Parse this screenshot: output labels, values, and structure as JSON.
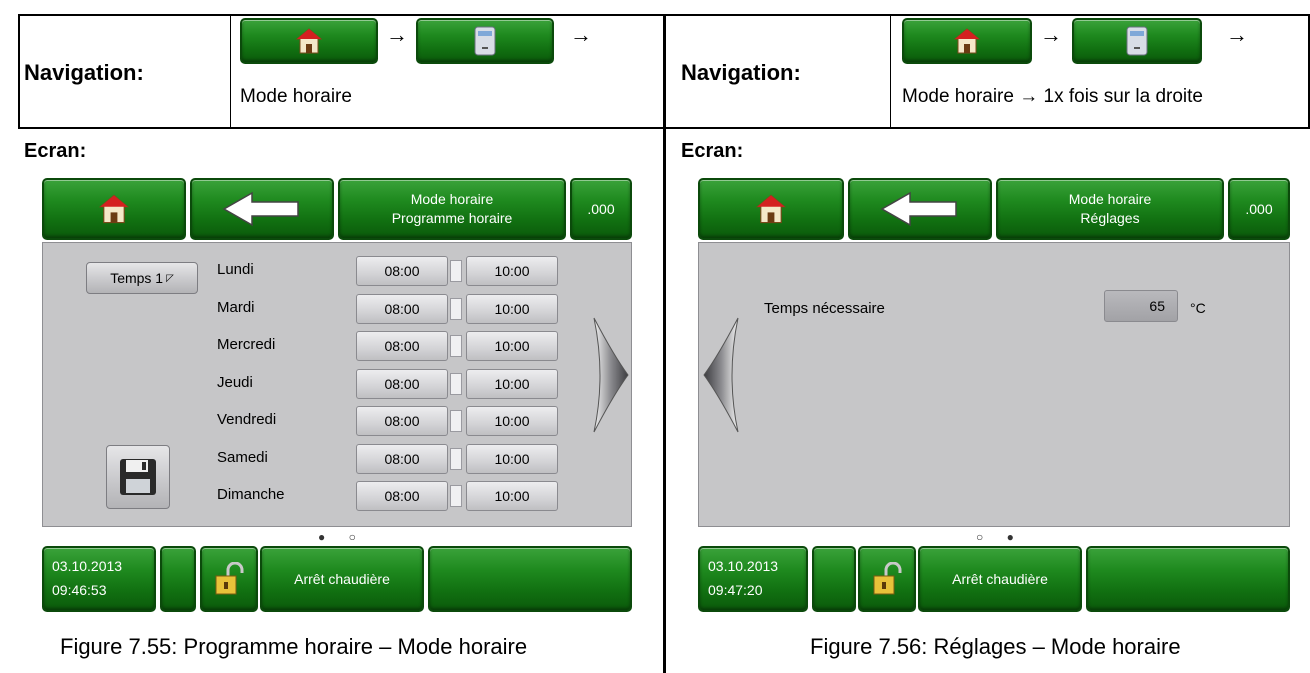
{
  "left": {
    "nav_label": "Navigation:",
    "nav_path": "Mode horaire",
    "ecran_label": "Ecran:",
    "header": {
      "home_icon": "house-icon",
      "back_icon": "back-arrow-icon",
      "title_line1": "Mode horaire",
      "title_line2": "Programme horaire",
      "code": ".000"
    },
    "temps_button": "Temps 1",
    "days": [
      {
        "name": "Lundi",
        "start": "08:00",
        "end": "10:00"
      },
      {
        "name": "Mardi",
        "start": "08:00",
        "end": "10:00"
      },
      {
        "name": "Mercredi",
        "start": "08:00",
        "end": "10:00"
      },
      {
        "name": "Jeudi",
        "start": "08:00",
        "end": "10:00"
      },
      {
        "name": "Vendredi",
        "start": "08:00",
        "end": "10:00"
      },
      {
        "name": "Samedi",
        "start": "08:00",
        "end": "10:00"
      },
      {
        "name": "Dimanche",
        "start": "08:00",
        "end": "10:00"
      }
    ],
    "separator": "-",
    "pager": "● ○",
    "footer": {
      "date": "03.10.2013",
      "time": "09:46:53",
      "status": "Arrêt chaudière"
    },
    "caption": "Figure 7.55: Programme horaire – Mode horaire"
  },
  "right": {
    "nav_label": "Navigation:",
    "nav_path": "Mode horaire → 1x fois sur la droite",
    "ecran_label": "Ecran:",
    "header": {
      "title_line1": "Mode horaire",
      "title_line2": "Réglages",
      "code": ".000"
    },
    "setting_label": "Temps nécessaire",
    "setting_value": "65",
    "setting_unit": "°C",
    "pager": "○ ●",
    "footer": {
      "date": "03.10.2013",
      "time": "09:47:20",
      "status": "Arrêt chaudière"
    },
    "caption": "Figure 7.56: Réglages – Mode horaire"
  },
  "arrow": "→",
  "colors": {
    "green": "#1f8a1f",
    "screen_grey": "#c6c6c8"
  }
}
